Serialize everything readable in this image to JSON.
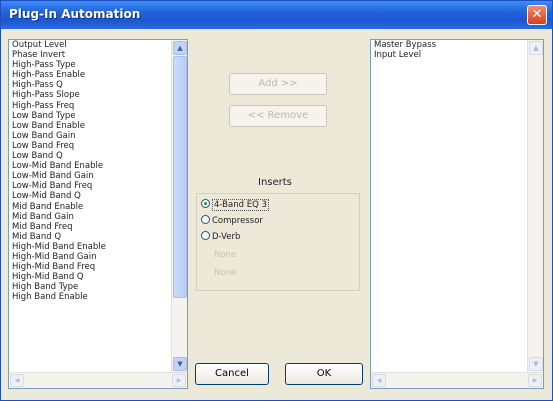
{
  "window": {
    "title": "Plug-In Automation",
    "close_glyph": "✕"
  },
  "left_list": {
    "items": [
      "Output Level",
      "Phase Invert",
      "High-Pass Type",
      "High-Pass Enable",
      "High-Pass Q",
      "High-Pass Slope",
      "High-Pass Freq",
      "Low Band Type",
      "Low Band Enable",
      "Low Band Gain",
      "Low Band Freq",
      "Low Band Q",
      "Low-Mid Band Enable",
      "Low-Mid Band Gain",
      "Low-Mid Band Freq",
      "Low-Mid Band Q",
      "Mid Band Enable",
      "Mid Band Gain",
      "Mid Band Freq",
      "Mid Band Q",
      "High-Mid Band Enable",
      "High-Mid Band Gain",
      "High-Mid Band Freq",
      "High-Mid Band Q",
      "High Band Type",
      "High Band Enable"
    ]
  },
  "buttons": {
    "add_label": "Add >>",
    "remove_label": "<< Remove",
    "cancel_label": "Cancel",
    "ok_label": "OK"
  },
  "inserts": {
    "label": "Inserts",
    "options": [
      {
        "label": "4-Band EQ 3",
        "selected": true,
        "enabled": true
      },
      {
        "label": "Compressor",
        "selected": false,
        "enabled": true
      },
      {
        "label": "D-Verb",
        "selected": false,
        "enabled": true
      },
      {
        "label": "None",
        "selected": false,
        "enabled": false
      },
      {
        "label": "None",
        "selected": false,
        "enabled": false
      }
    ]
  },
  "right_list": {
    "items": [
      "Master Bypass",
      "Input Level"
    ]
  },
  "icons": {
    "scroll_up": "up-arrow-icon",
    "scroll_down": "down-arrow-icon",
    "scroll_left": "left-arrow-icon",
    "scroll_right": "right-arrow-icon"
  },
  "colors": {
    "titlebar": "#2163d9",
    "dialog_bg": "#ece9d8",
    "close_button": "#d7401d",
    "radio_dot": "#21a121"
  }
}
